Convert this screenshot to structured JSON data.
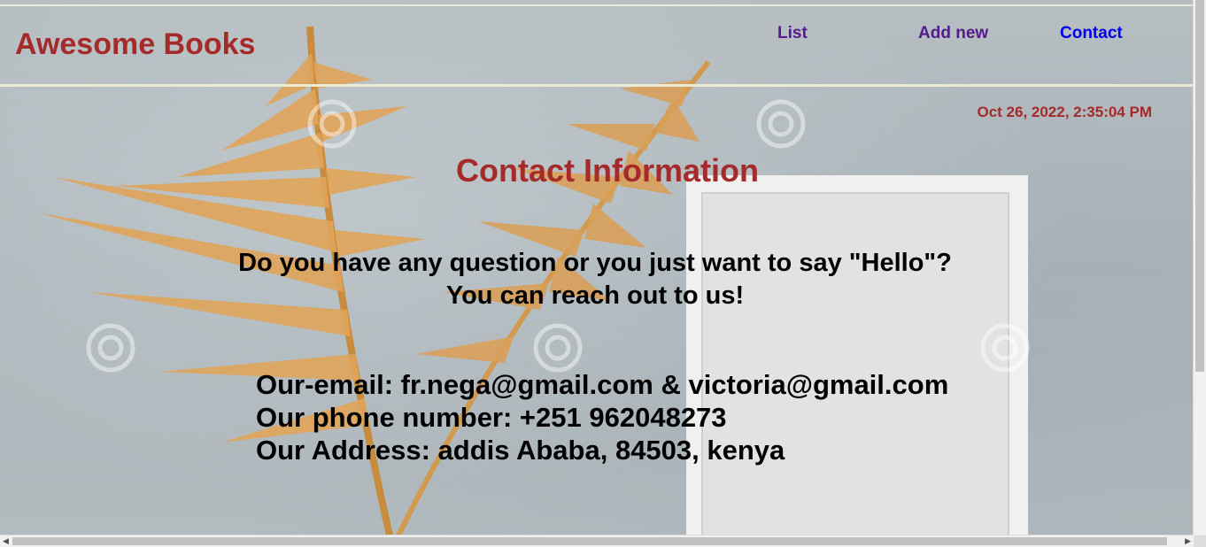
{
  "header": {
    "brand": "Awesome Books",
    "nav": {
      "list": "List",
      "add_new": "Add new",
      "contact": "Contact"
    }
  },
  "datetime": "Oct 26, 2022, 2:35:04 PM",
  "contact": {
    "title": "Contact Information",
    "question_line1": "Do you have any question or you just want to say \"Hello\"?",
    "question_line2": "You can reach out to us!",
    "email": "Our-email: fr.nega@gmail.com & victoria@gmail.com",
    "phone": "Our phone number: +251 962048273",
    "address": "Our Address: addis Ababa, 84503, kenya"
  },
  "colors": {
    "brand": "#a52a2a",
    "nav_visited": "#551a8b",
    "nav_link": "#0000ee",
    "text": "#000000"
  },
  "icons": {
    "scroll_left": "left-arrow-icon",
    "scroll_right": "right-arrow-icon"
  }
}
